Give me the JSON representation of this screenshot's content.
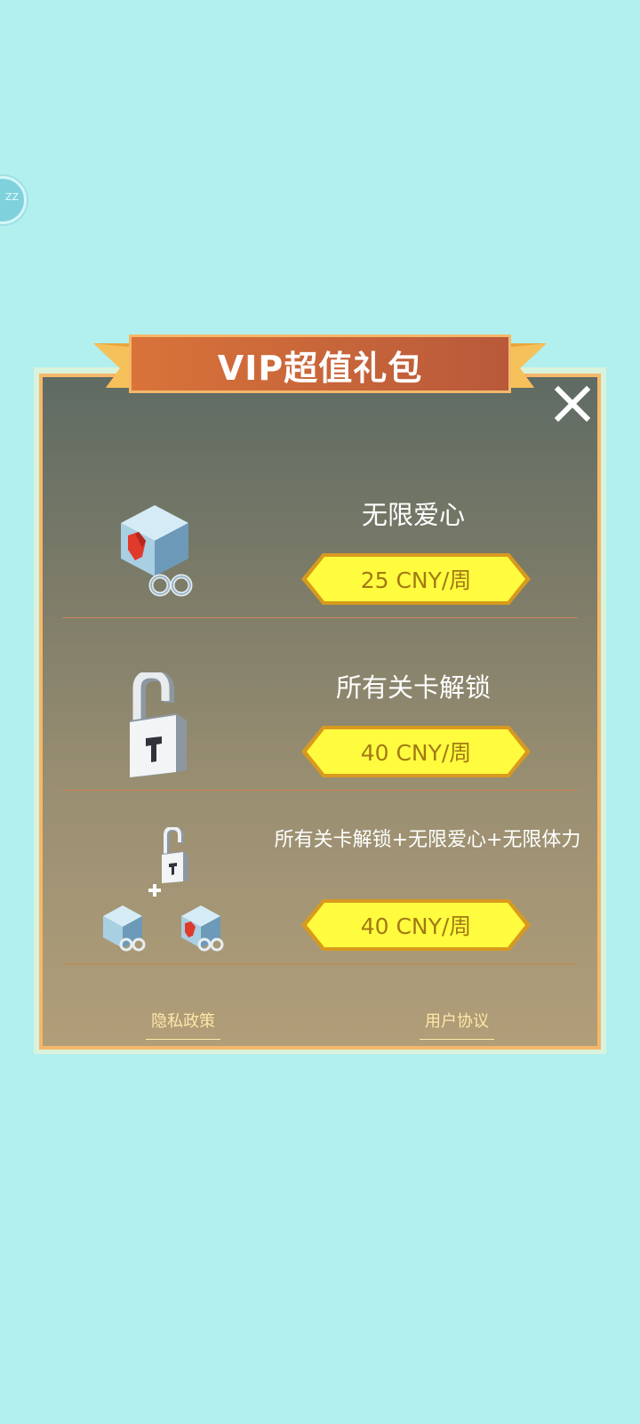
{
  "floating_button": {
    "text": "ZZ"
  },
  "dialog": {
    "title": "VIP超值礼包",
    "items": [
      {
        "title": "无限爱心",
        "price": "25 CNY/周",
        "icon": "infinite-hearts-cube-icon"
      },
      {
        "title": "所有关卡解锁",
        "price": "40 CNY/周",
        "icon": "padlock-icon"
      },
      {
        "title": "所有关卡解锁+无限爱心+无限体力",
        "price": "40 CNY/周",
        "icon": "bundle-icon"
      }
    ],
    "links": {
      "privacy": "隐私政策",
      "terms": "用户协议"
    }
  },
  "colors": {
    "background": "#b2f0ef",
    "ribbon": "#d9733a",
    "price_button": "#fffb3f",
    "price_text": "#a27a12"
  }
}
